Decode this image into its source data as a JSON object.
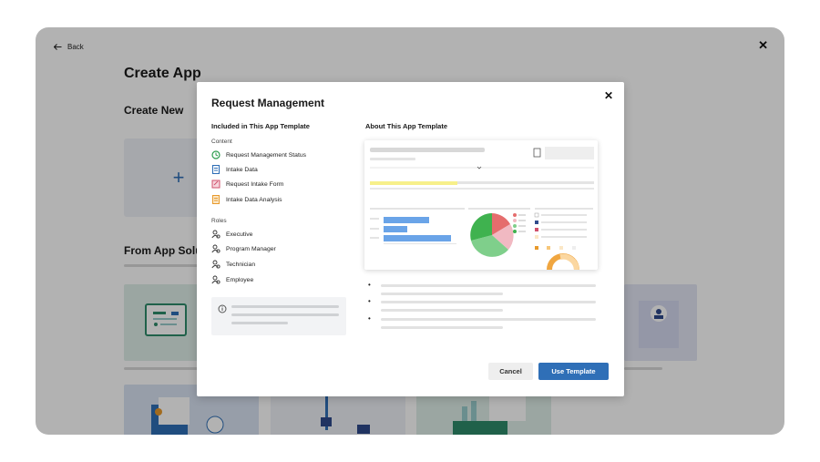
{
  "page": {
    "back_label": "Back",
    "title": "Create App",
    "create_new_heading": "Create New",
    "from_solutions_heading": "From App Solu",
    "new_card_symbol": "+"
  },
  "modal": {
    "title": "Request Management",
    "close_symbol": "✕",
    "included_heading": "Included in This App Template",
    "about_heading": "About This App Template",
    "content_label": "Content",
    "content_items": [
      {
        "label": "Request Management Status",
        "icon": "status-icon",
        "color": "#2e9e4f"
      },
      {
        "label": "Intake Data",
        "icon": "data-icon",
        "color": "#2f6fb7"
      },
      {
        "label": "Request Intake Form",
        "icon": "form-icon",
        "color": "#d0506b"
      },
      {
        "label": "Intake Data Analysis",
        "icon": "analysis-icon",
        "color": "#e89a2c"
      }
    ],
    "roles_label": "Roles",
    "roles": [
      {
        "label": "Executive"
      },
      {
        "label": "Program Manager"
      },
      {
        "label": "Technician"
      },
      {
        "label": "Employee"
      }
    ],
    "bullet_symbol": "•",
    "cancel_label": "Cancel",
    "use_template_label": "Use Template"
  },
  "colors": {
    "accent": "#2f6fb7",
    "overlay": "rgba(0,0,0,0.30)",
    "highlight": "#f7f08a"
  }
}
